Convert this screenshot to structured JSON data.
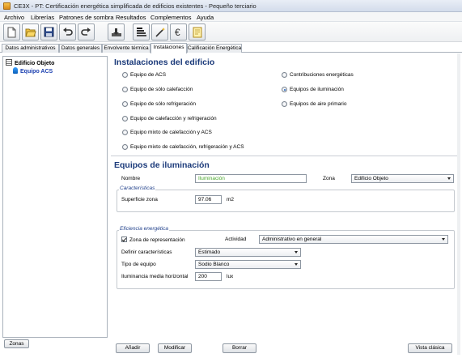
{
  "window": {
    "title": "CE3X - PT: Certificación energética simplificada de edificios existentes - Pequeño terciario"
  },
  "menu": [
    "Archivo",
    "Librerías",
    "Patrones de sombra",
    "Resultados",
    "Complementos",
    "Ayuda"
  ],
  "toolbar": {
    "icons": [
      "new-file-icon",
      "open-folder-icon",
      "save-icon",
      "undo-icon",
      "redo-icon",
      "import-icon",
      "chart-icon",
      "magic-wand-icon",
      "euro-icon",
      "report-icon"
    ]
  },
  "tabs": [
    "Datos administrativos",
    "Datos generales",
    "Envolvente térmica",
    "Instalaciones",
    "Calificación Energética"
  ],
  "active_tab": "Instalaciones",
  "tree": {
    "root": "Edificio Objeto",
    "child": "Equipo ACS"
  },
  "left_button": "Zonas",
  "instalaciones": {
    "title": "Instalaciones del edificio",
    "options_left": [
      "Equipo de ACS",
      "Equipo de sólo calefacción",
      "Equipo de sólo refrigeración",
      "Equipo de calefacción y refrigeración",
      "Equipo mixto de calefacción y ACS",
      "Equipo mixto de calefacción, refrigeración y ACS"
    ],
    "options_right": [
      "Contribuciones energéticas",
      "Equipos de iluminación",
      "Equipos de aire primario"
    ],
    "selected": "Equipos de iluminación"
  },
  "iluminacion": {
    "title": "Equipos de iluminación",
    "nombre_label": "Nombre",
    "nombre_value": "Iluminación",
    "zona_label": "Zona",
    "zona_value": "Edificio Objeto",
    "caracteristicas_title": "Características",
    "superficie_label": "Superficie zona",
    "superficie_value": "97.06",
    "superficie_unit": "m2",
    "eficiencia_title": "Eficiencia energética",
    "zona_representacion_label": "Zona de representación",
    "zona_representacion_checked": true,
    "actividad_label": "Actividad",
    "actividad_value": "Administrativo en general",
    "definir_label": "Definir características",
    "definir_value": "Estimado",
    "tipo_label": "Tipo de equipo",
    "tipo_value": "Sodio Blanco",
    "iluminancia_label": "Iluminancia media horizontal",
    "iluminancia_value": "200",
    "iluminancia_unit": "lux"
  },
  "actions": {
    "add": "Añadir",
    "modify": "Modificar",
    "delete": "Borrar",
    "classic": "Vista clásica"
  },
  "colors": {
    "heading": "#1b3a7a",
    "name_value": "#4da82f",
    "tree_child": "#1a3fb0"
  }
}
